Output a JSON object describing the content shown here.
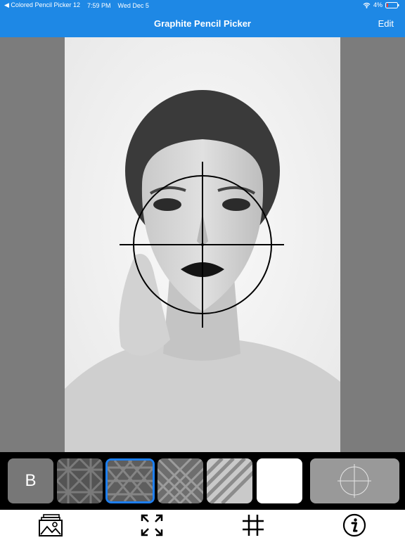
{
  "status_bar": {
    "back_app": "Colored Pencil Picker 12",
    "time": "7:59 PM",
    "date": "Wed Dec 5",
    "battery": "4%"
  },
  "nav": {
    "title": "Graphite Pencil Picker",
    "edit_label": "Edit"
  },
  "palette": {
    "grade_label": "B",
    "swatches": [
      {
        "pattern": "dark-lattice",
        "selected": false
      },
      {
        "pattern": "dark-crosshatch",
        "selected": true
      },
      {
        "pattern": "medium-crosshatch",
        "selected": false
      },
      {
        "pattern": "light-diagonal",
        "selected": false
      },
      {
        "pattern": "white",
        "selected": false
      }
    ]
  },
  "tabs": [
    "photo-icon",
    "expand-icon",
    "grid-icon",
    "info-icon"
  ],
  "colors": {
    "accent": "#1e88e5",
    "selection": "#1e7ff0"
  }
}
